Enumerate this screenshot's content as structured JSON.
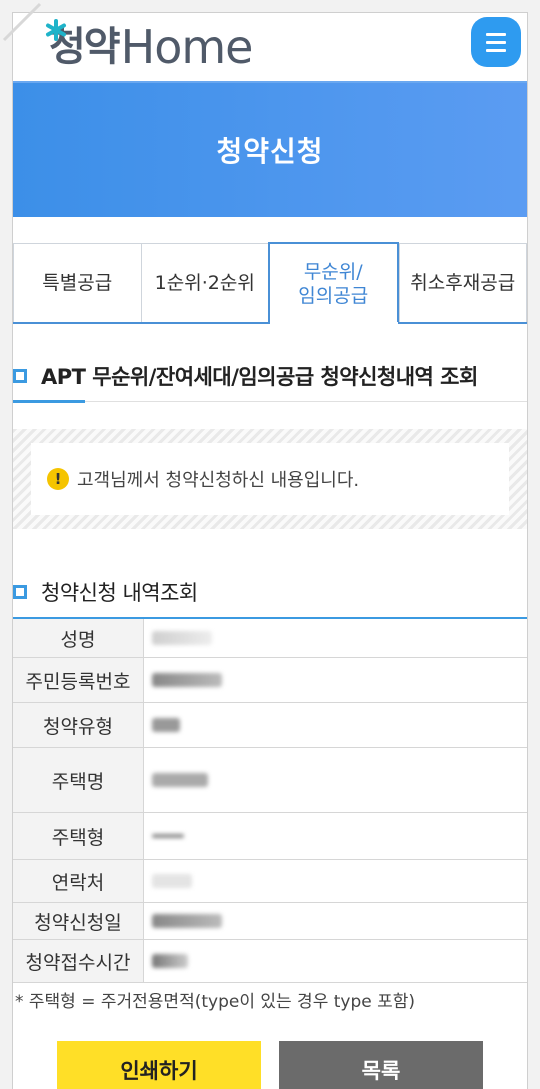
{
  "header": {
    "logo_ko": "청약",
    "logo_en": "Home",
    "menu_icon": "hamburger-icon",
    "brand_color": "#2e9bf0"
  },
  "banner": {
    "title": "청약신청",
    "color": "#4a94ec"
  },
  "tabs": [
    {
      "label": "특별공급",
      "active": false
    },
    {
      "label": "1순위·2순위",
      "active": false
    },
    {
      "label": "무순위/ 임의공급",
      "active": true
    },
    {
      "label": "취소후재공급",
      "active": false
    }
  ],
  "section1": {
    "title": "APT 무순위/잔여세대/임의공급 청약신청내역 조회"
  },
  "notice": {
    "icon": "exclamation-icon",
    "text": "고객님께서 청약신청하신 내용입니다."
  },
  "section2": {
    "title": "청약신청 내역조회"
  },
  "table": {
    "rows": [
      {
        "label": "성명"
      },
      {
        "label": "주민등록번호"
      },
      {
        "label": "청약유형"
      },
      {
        "label": "주택명"
      },
      {
        "label": "주택형"
      },
      {
        "label": "연락처"
      },
      {
        "label": "청약신청일"
      },
      {
        "label": "청약접수시간"
      }
    ]
  },
  "footnote": "* 주택형 = 주거전용면적(type이 있는 경우 type 포함)",
  "buttons": {
    "print": "인쇄하기",
    "list": "목록"
  }
}
